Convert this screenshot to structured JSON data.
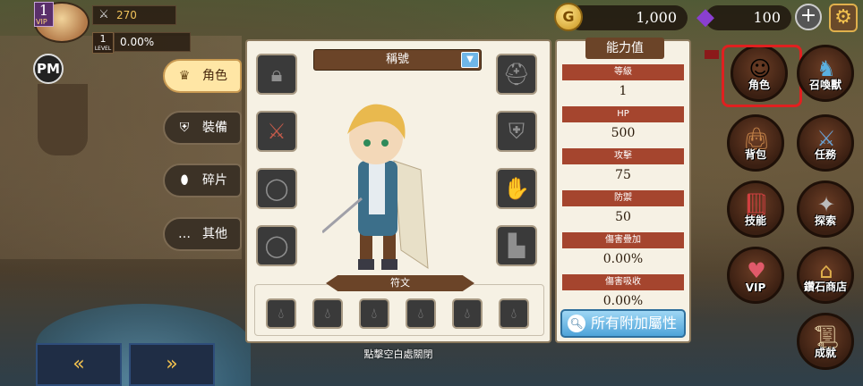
{
  "player": {
    "level": "1",
    "vip": "VIP",
    "power": "270",
    "sub_level": "1",
    "sub_level_caption": "LEVEL",
    "exp": "0.00%",
    "pm": "PM"
  },
  "currency": {
    "gold": "1,000",
    "gem": "100",
    "coin_glyph": "G"
  },
  "tabs": [
    {
      "label": "角色",
      "icon": "crown-icon",
      "active": true
    },
    {
      "label": "裝備",
      "icon": "armor-icon",
      "active": false
    },
    {
      "label": "碎片",
      "icon": "shard-icon",
      "active": false
    },
    {
      "label": "其他",
      "icon": "ellipsis-icon",
      "active": false
    }
  ],
  "panel": {
    "title_dropdown": "稱號",
    "rune_label": "符文",
    "hint": "點擊空白處關閉"
  },
  "stats": {
    "title": "能力值",
    "rows": [
      {
        "label": "等級",
        "value": "1"
      },
      {
        "label": "HP",
        "value": "500"
      },
      {
        "label": "攻擊",
        "value": "75"
      },
      {
        "label": "防禦",
        "value": "50"
      },
      {
        "label": "傷害疊加",
        "value": "0.00%"
      },
      {
        "label": "傷害吸收",
        "value": "0.00%"
      }
    ],
    "button": "所有附加屬性"
  },
  "menu": [
    {
      "label": "角色",
      "icon": "character-icon"
    },
    {
      "label": "召喚獸",
      "icon": "summon-icon"
    },
    {
      "label": "背包",
      "icon": "bag-icon"
    },
    {
      "label": "任務",
      "icon": "quest-icon"
    },
    {
      "label": "技能",
      "icon": "skill-book-icon"
    },
    {
      "label": "探索",
      "icon": "explore-icon"
    },
    {
      "label": "VIP",
      "icon": "vip-icon"
    },
    {
      "label": "鑽石商店",
      "icon": "shop-icon"
    },
    {
      "label": "成就",
      "icon": "achievement-icon"
    }
  ],
  "nav": {
    "prev": "«",
    "next": "»"
  },
  "colors": {
    "accent_red": "#a5452e",
    "panel_bg": "#f6f1e4",
    "brown": "#6b4428",
    "highlight": "#e02020"
  }
}
